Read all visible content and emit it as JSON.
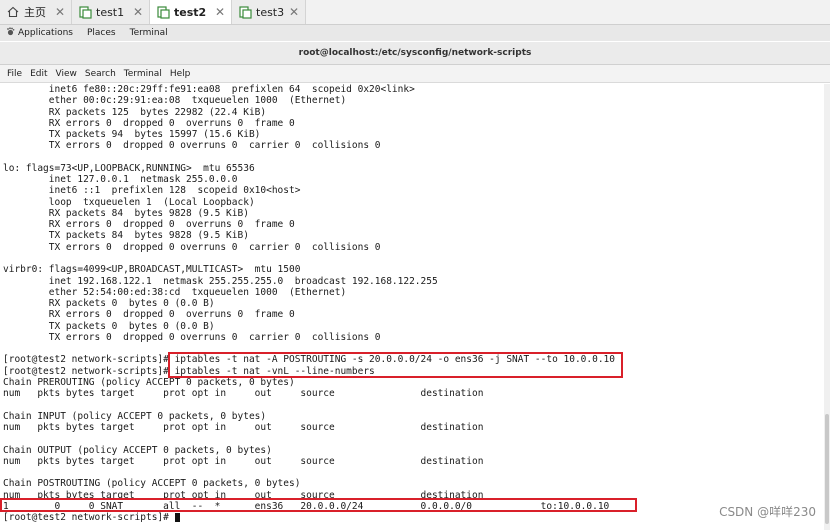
{
  "tabs": [
    {
      "label": "主页",
      "icon": "home-icon",
      "active": false
    },
    {
      "label": "test1",
      "icon": "terminal-icon",
      "active": false
    },
    {
      "label": "test2",
      "icon": "terminal-icon",
      "active": true
    },
    {
      "label": "test3",
      "icon": "terminal-icon",
      "active": false
    }
  ],
  "gnome_bar": {
    "applications": "Applications",
    "places": "Places",
    "terminal": "Terminal"
  },
  "window": {
    "title": "root@localhost:/etc/sysconfig/network-scripts"
  },
  "menu": [
    "File",
    "Edit",
    "View",
    "Search",
    "Terminal",
    "Help"
  ],
  "terminal_lines": [
    "        inet6 fe80::20c:29ff:fe91:ea08  prefixlen 64  scopeid 0x20<link>",
    "        ether 00:0c:29:91:ea:08  txqueuelen 1000  (Ethernet)",
    "        RX packets 125  bytes 22982 (22.4 KiB)",
    "        RX errors 0  dropped 0  overruns 0  frame 0",
    "        TX packets 94  bytes 15997 (15.6 KiB)",
    "        TX errors 0  dropped 0 overruns 0  carrier 0  collisions 0",
    "",
    "lo: flags=73<UP,LOOPBACK,RUNNING>  mtu 65536",
    "        inet 127.0.0.1  netmask 255.0.0.0",
    "        inet6 ::1  prefixlen 128  scopeid 0x10<host>",
    "        loop  txqueuelen 1  (Local Loopback)",
    "        RX packets 84  bytes 9828 (9.5 KiB)",
    "        RX errors 0  dropped 0  overruns 0  frame 0",
    "        TX packets 84  bytes 9828 (9.5 KiB)",
    "        TX errors 0  dropped 0 overruns 0  carrier 0  collisions 0",
    "",
    "virbr0: flags=4099<UP,BROADCAST,MULTICAST>  mtu 1500",
    "        inet 192.168.122.1  netmask 255.255.255.0  broadcast 192.168.122.255",
    "        ether 52:54:00:ed:38:cd  txqueuelen 1000  (Ethernet)",
    "        RX packets 0  bytes 0 (0.0 B)",
    "        RX errors 0  dropped 0  overruns 0  frame 0",
    "        TX packets 0  bytes 0 (0.0 B)",
    "        TX errors 0  dropped 0 overruns 0  carrier 0  collisions 0",
    "",
    "[root@test2 network-scripts]# iptables -t nat -A POSTROUTING -s 20.0.0.0/24 -o ens36 -j SNAT --to 10.0.0.10",
    "[root@test2 network-scripts]# iptables -t nat -vnL --line-numbers",
    "Chain PREROUTING (policy ACCEPT 0 packets, 0 bytes)",
    "num   pkts bytes target     prot opt in     out     source               destination",
    "",
    "Chain INPUT (policy ACCEPT 0 packets, 0 bytes)",
    "num   pkts bytes target     prot opt in     out     source               destination",
    "",
    "Chain OUTPUT (policy ACCEPT 0 packets, 0 bytes)",
    "num   pkts bytes target     prot opt in     out     source               destination",
    "",
    "Chain POSTROUTING (policy ACCEPT 0 packets, 0 bytes)",
    "num   pkts bytes target     prot opt in     out     source               destination",
    "1        0     0 SNAT       all  --  *      ens36   20.0.0.0/24          0.0.0.0/0            to:10.0.0.10",
    "[root@test2 network-scripts]# "
  ],
  "watermark": "CSDN @咩咩230"
}
